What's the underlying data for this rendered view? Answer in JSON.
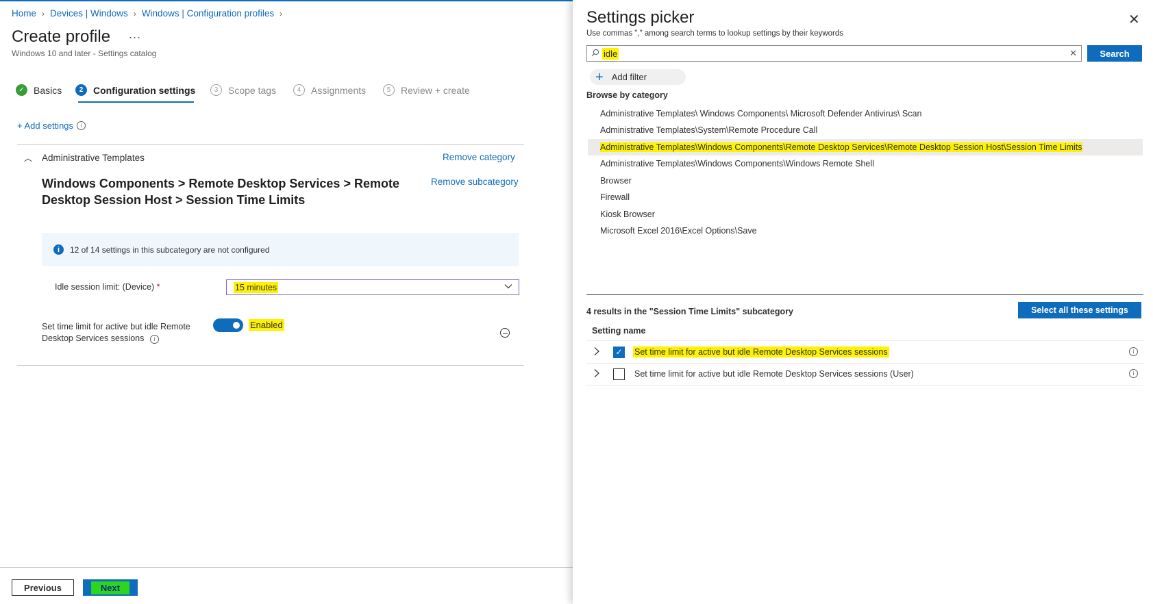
{
  "breadcrumb": [
    "Home",
    "Devices | Windows",
    "Windows | Configuration profiles"
  ],
  "page": {
    "title": "Create profile",
    "more": "...",
    "subtitle": "Windows 10 and later - Settings catalog"
  },
  "steps": [
    {
      "num": "✓",
      "label": "Basics",
      "state": "done"
    },
    {
      "num": "2",
      "label": "Configuration settings",
      "state": "active"
    },
    {
      "num": "3",
      "label": "Scope tags",
      "state": "todo"
    },
    {
      "num": "4",
      "label": "Assignments",
      "state": "todo"
    },
    {
      "num": "5",
      "label": "Review + create",
      "state": "todo"
    }
  ],
  "add_settings": "+ Add settings",
  "category": {
    "name": "Administrative Templates",
    "remove_category": "Remove category",
    "subcategory_title": "Windows Components > Remote Desktop Services > Remote Desktop Session Host > Session Time Limits",
    "remove_subcategory": "Remove subcategory",
    "info": "12 of 14 settings in this subcategory are not configured",
    "idle_label": "Idle session limit: (Device)",
    "required_mark": "*",
    "idle_value": "15 minutes",
    "toggle_label": "Set time limit for active but idle Remote Desktop Services sessions",
    "toggle_state": "Enabled"
  },
  "footer": {
    "previous": "Previous",
    "next": "Next"
  },
  "picker": {
    "title": "Settings picker",
    "subtitle": "Use commas \",\" among search terms to lookup settings by their keywords",
    "search_value": "idle",
    "search_button": "Search",
    "add_filter": "Add filter",
    "browse_label": "Browse by category",
    "categories": [
      "Administrative Templates\\ Windows Components\\ Microsoft Defender Antivirus\\ Scan",
      "Administrative Templates\\System\\Remote Procedure Call",
      "Administrative Templates\\Windows Components\\Remote Desktop Services\\Remote Desktop Session Host\\Session Time Limits",
      "Administrative Templates\\Windows Components\\Windows Remote Shell",
      "Browser",
      "Firewall",
      "Kiosk Browser",
      "Microsoft Excel 2016\\Excel Options\\Save"
    ],
    "selected_category_index": 2,
    "results_label": "4 results in the \"Session Time Limits\" subcategory",
    "select_all": "Select all these settings",
    "column_header": "Setting name",
    "results": [
      {
        "name": "Set time limit for active but idle Remote Desktop Services sessions",
        "checked": true
      },
      {
        "name": "Set time limit for active but idle Remote Desktop Services sessions (User)",
        "checked": false
      }
    ]
  },
  "colors": {
    "accent": "#0f6cbd",
    "highlight": "#fff200",
    "success": "#3a9c37",
    "next_highlight": "#2bd61f"
  }
}
